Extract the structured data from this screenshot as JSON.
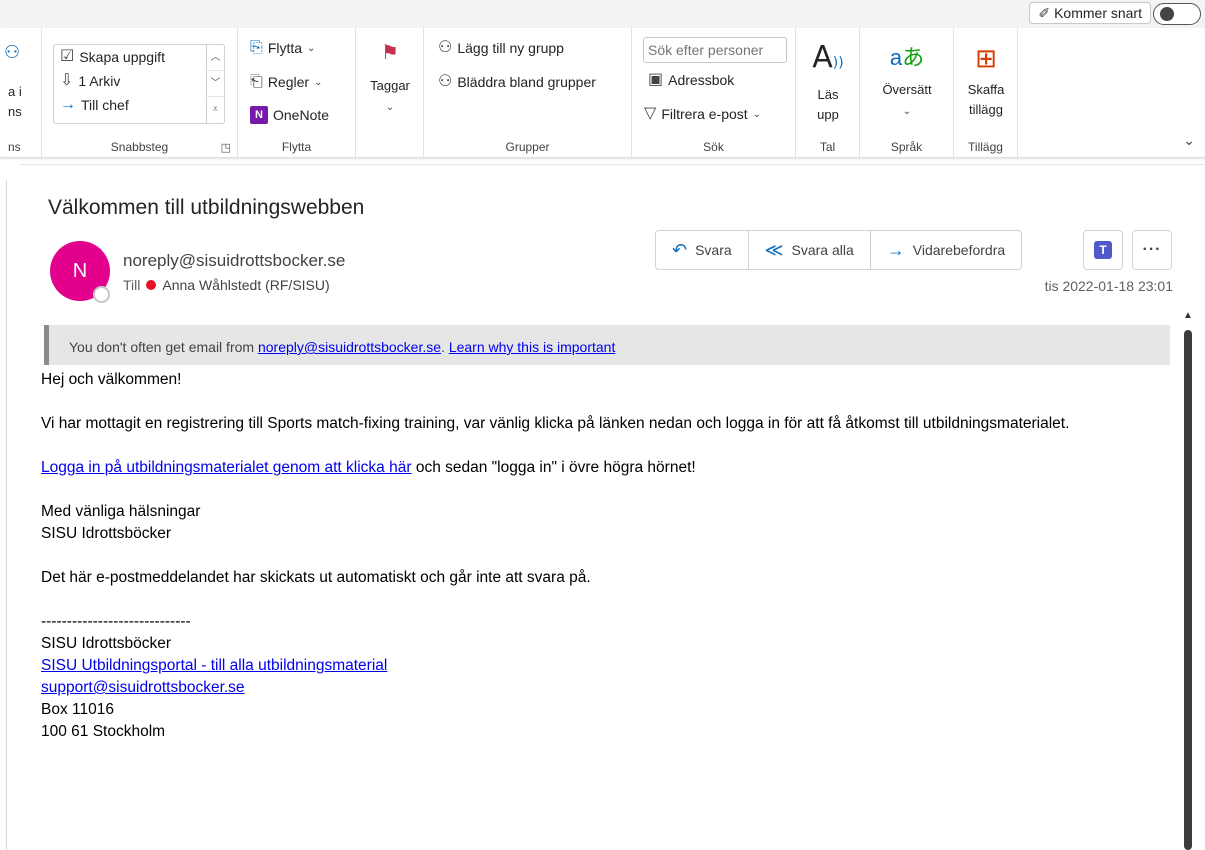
{
  "topbar": {
    "coming_soon_label": "Kommer snart"
  },
  "ribbon": {
    "partial_group": {
      "line1": "a i",
      "line2": "ns",
      "group_label": "ns"
    },
    "snabbsteg": {
      "items": [
        "Skapa uppgift",
        "1 Arkiv",
        "Till chef"
      ],
      "group_label": "Snabbsteg"
    },
    "flytta": {
      "items": [
        "Flytta",
        "Regler",
        "OneNote"
      ],
      "group_label": "Flytta"
    },
    "taggar": {
      "label": "Taggar"
    },
    "grupper": {
      "items": [
        "Lägg till ny grupp",
        "Bläddra bland grupper"
      ],
      "group_label": "Grupper"
    },
    "sok": {
      "search_placeholder": "Sök efter personer",
      "items": [
        "Adressbok",
        "Filtrera e-post"
      ],
      "group_label": "Sök"
    },
    "tal": {
      "label_line1": "Läs",
      "label_line2": "upp",
      "group_label": "Tal"
    },
    "sprak": {
      "label": "Översätt",
      "group_label": "Språk"
    },
    "tillagg": {
      "label_line1": "Skaffa",
      "label_line2": "tillägg",
      "group_label": "Tillägg"
    }
  },
  "message": {
    "subject": "Välkommen till utbildningswebben",
    "avatar_initial": "N",
    "avatar_color": "#e3008c",
    "sender": "noreply@sisuidrottsbocker.se",
    "to_label": "Till",
    "to_name": "Anna Wåhlstedt (RF/SISU)",
    "date": "tis 2022-01-18 23:01",
    "actions": {
      "reply": "Svara",
      "reply_all": "Svara alla",
      "forward": "Vidarebefordra"
    }
  },
  "banner": {
    "prefix": "You don't often get email from ",
    "sender_link": "noreply@sisuidrottsbocker.se",
    "separator": ". ",
    "learn_link": "Learn why this is important"
  },
  "body": {
    "greeting": "Hej och välkommen!",
    "para1": "Vi har mottagit en registrering till Sports match-fixing training, var vänlig klicka på länken nedan och logga in för att få åtkomst till utbildningsmaterialet.",
    "login_link": "Logga in på utbildningsmaterialet genom att klicka här",
    "login_suffix": " och sedan \"logga in\" i övre högra hörnet!",
    "regards": "Med vänliga hälsningar",
    "signature": "SISU Idrottsböcker",
    "notice": "Det här e-postmeddelandet har skickats ut automatiskt och går inte att svara på.",
    "divider": "-----------------------------",
    "footer_name": "SISU Idrottsböcker",
    "portal_link": "SISU Utbildningsportal - till alla utbildningsmaterial",
    "support_link": "support@sisuidrottsbocker.se",
    "address1": "Box 11016",
    "address2": "100 61 Stockholm"
  }
}
